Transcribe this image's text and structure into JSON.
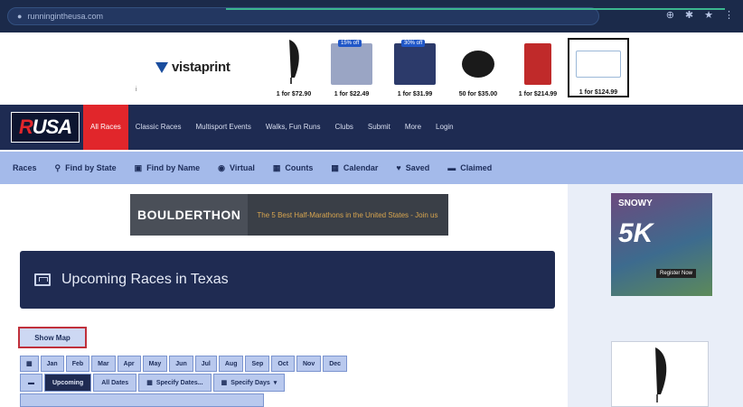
{
  "browser": {
    "url": "runningintheusa.com",
    "icons": [
      "extension-icon",
      "star-icon",
      "profile-icon",
      "menu-icon"
    ]
  },
  "ad": {
    "brand": "vistaprint",
    "products": [
      {
        "price": "1 for $72.90",
        "badge": ""
      },
      {
        "price": "1 for $22.49",
        "badge": "15% off"
      },
      {
        "price": "1 for $31.99",
        "badge": "30% off"
      },
      {
        "price": "50 for $35.00",
        "badge": ""
      },
      {
        "price": "1 for $214.99",
        "badge": ""
      },
      {
        "price": "1 for $124.99",
        "badge": ""
      }
    ]
  },
  "site": {
    "logo_a": "R",
    "logo_b": "USA",
    "nav": [
      {
        "label": "All Races",
        "active": true
      },
      {
        "label": "Classic Races",
        "active": false
      },
      {
        "label": "Multisport Events",
        "active": false
      },
      {
        "label": "Walks, Fun Runs",
        "active": false
      },
      {
        "label": "Clubs",
        "active": false
      },
      {
        "label": "Submit",
        "active": false
      },
      {
        "label": "More",
        "active": false
      },
      {
        "label": "Login",
        "active": false
      }
    ]
  },
  "races_bar": {
    "title": "Races",
    "items": [
      {
        "label": "Find by State",
        "icon": "⚲"
      },
      {
        "label": "Find by Name",
        "icon": "▣"
      },
      {
        "label": "Virtual",
        "icon": "◉"
      },
      {
        "label": "Counts",
        "icon": "▦"
      },
      {
        "label": "Calendar",
        "icon": "▦"
      },
      {
        "label": "Saved",
        "icon": "♥"
      },
      {
        "label": "Claimed",
        "icon": "▬"
      }
    ]
  },
  "boulderthon": {
    "title": "BOULDERTHON",
    "subtitle": "The 5 Best Half-Marathons in the United States - Join us"
  },
  "heading": "Upcoming Races in Texas",
  "show_map": "Show Map",
  "months": [
    "Jan",
    "Feb",
    "Mar",
    "Apr",
    "May",
    "Jun",
    "Jul",
    "Aug",
    "Sep",
    "Oct",
    "Nov",
    "Dec"
  ],
  "filters": {
    "upcoming": "Upcoming",
    "all_dates": "All Dates",
    "specify_dates": "Specify Dates...",
    "specify_days": "Specify Days"
  },
  "sidebar_ad": {
    "tag": "SNOWY",
    "big": "5K",
    "cta": "Register Now"
  }
}
